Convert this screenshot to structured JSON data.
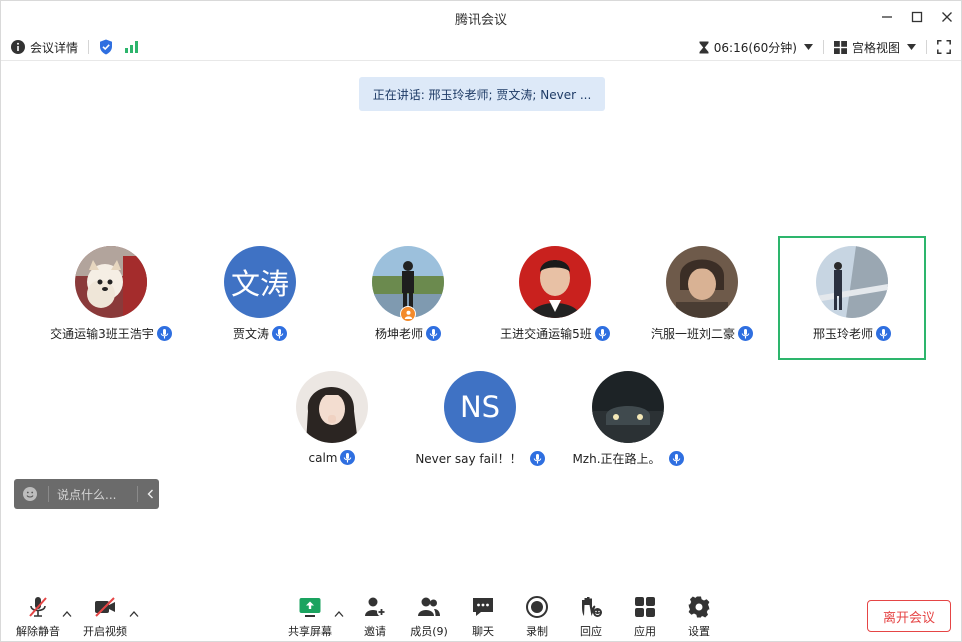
{
  "window": {
    "title": "腾讯会议"
  },
  "infobar": {
    "meeting_details": "会议详情",
    "timer": "06:16(60分钟)",
    "view_mode": "宫格视图"
  },
  "speaking": {
    "text": "正在讲话: 邢玉玲老师; 贾文涛; Never ..."
  },
  "participants": [
    {
      "name": "交通运输3班王浩宇",
      "avatar": "photo-dog"
    },
    {
      "name": "贾文涛",
      "avatar_text": "文涛",
      "avatar_color": "#3f72c4"
    },
    {
      "name": "杨坤老师",
      "avatar": "photo-person-outdoor",
      "host": true
    },
    {
      "name": "王进交通运输5班",
      "avatar": "photo-portrait-red"
    },
    {
      "name": "汽服一班刘二豪",
      "avatar": "photo-anime-boy"
    },
    {
      "name": "邢玉玲老师",
      "avatar": "photo-bridge",
      "active": true
    },
    {
      "name": "calm",
      "avatar": "photo-girl"
    },
    {
      "name": "Never say fail！！",
      "avatar_text": "NS",
      "avatar_color": "#3f72c4"
    },
    {
      "name": "Mzh.正在路上。",
      "avatar": "photo-car-night"
    }
  ],
  "chat": {
    "placeholder": "说点什么..."
  },
  "toolbar": {
    "unmute": "解除静音",
    "start_video": "开启视频",
    "share_screen": "共享屏幕",
    "invite": "邀请",
    "members": "成员(9)",
    "chat": "聊天",
    "record": "录制",
    "reactions": "回应",
    "apps": "应用",
    "settings": "设置",
    "leave": "离开会议"
  },
  "colors": {
    "accent": "#2f6fe0",
    "active_border": "#2db56c",
    "leave": "#e54545"
  }
}
